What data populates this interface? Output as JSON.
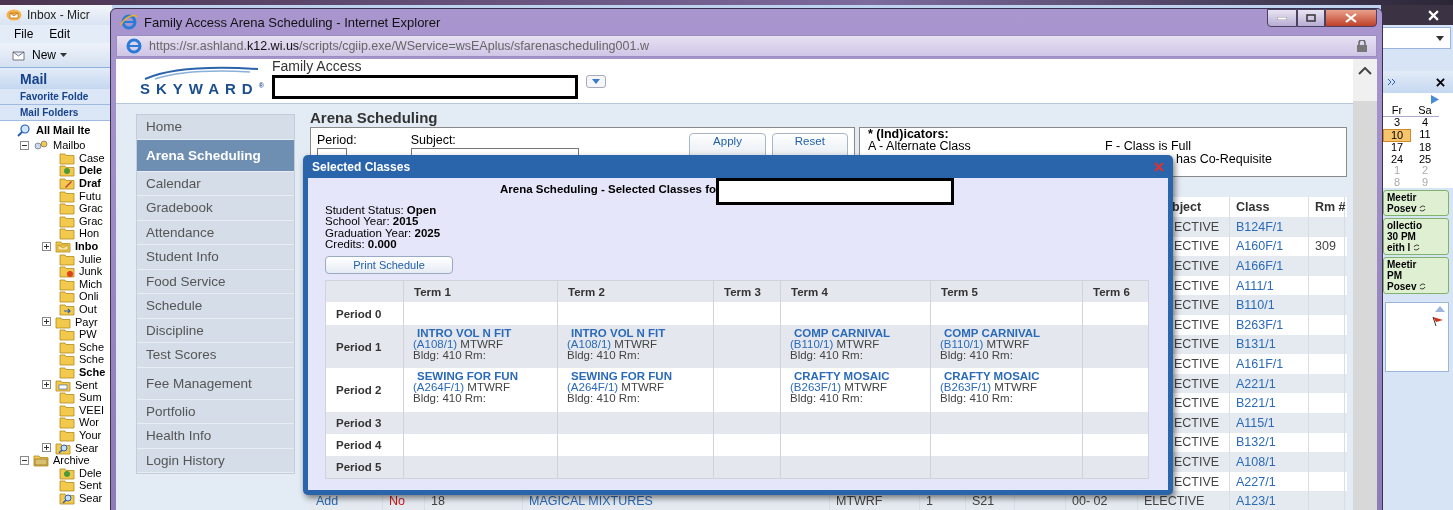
{
  "outlook": {
    "title": "Inbox - Micr",
    "menu": [
      "File",
      "Edit"
    ],
    "new_button": "New",
    "nav_title": "Mail",
    "sections": [
      "Favorite Folde",
      "Mail Folders"
    ],
    "all_items": "All Mail Ite",
    "folders": [
      {
        "label": "Mailbo",
        "kind": "mailbox",
        "unread": false,
        "expanded": true,
        "children": [
          {
            "label": "Case",
            "kind": "folder",
            "unread": false
          },
          {
            "label": "Dele",
            "kind": "trash",
            "unread": true
          },
          {
            "label": "Draf",
            "kind": "drafts",
            "unread": true
          },
          {
            "label": "Futu",
            "kind": "folder",
            "unread": false
          },
          {
            "label": "Grac",
            "kind": "folder",
            "unread": false
          },
          {
            "label": "Grac",
            "kind": "folder",
            "unread": false
          },
          {
            "label": "Hon",
            "kind": "folder",
            "unread": false
          },
          {
            "label": "Inbo",
            "kind": "inbox",
            "unread": true,
            "expanded": false
          },
          {
            "label": "Julie",
            "kind": "folder",
            "unread": false
          },
          {
            "label": "Junk",
            "kind": "junk",
            "unread": false
          },
          {
            "label": "Mich",
            "kind": "folder",
            "unread": false
          },
          {
            "label": "Onli",
            "kind": "folder",
            "unread": false
          },
          {
            "label": "Out",
            "kind": "outbox",
            "unread": false
          },
          {
            "label": "Payr",
            "kind": "folder",
            "unread": false,
            "expanded": false
          },
          {
            "label": "PW",
            "kind": "folder",
            "unread": false
          },
          {
            "label": "Sche",
            "kind": "folder",
            "unread": false
          },
          {
            "label": "Sche",
            "kind": "folder",
            "unread": false
          },
          {
            "label": "Sche",
            "kind": "folder",
            "unread": true
          },
          {
            "label": "Sent",
            "kind": "sent",
            "unread": false,
            "expanded": false
          },
          {
            "label": "Sum",
            "kind": "folder",
            "unread": false
          },
          {
            "label": "VEEI",
            "kind": "folder",
            "unread": false
          },
          {
            "label": "Wor",
            "kind": "folder",
            "unread": false
          },
          {
            "label": "Your",
            "kind": "folder",
            "unread": false
          },
          {
            "label": "Sear",
            "kind": "search",
            "unread": false,
            "expanded": false
          }
        ]
      },
      {
        "label": "Archive",
        "kind": "archive",
        "unread": false,
        "expanded": true,
        "children": [
          {
            "label": "Dele",
            "kind": "trash",
            "unread": false
          },
          {
            "label": "Sent",
            "kind": "folder",
            "unread": false
          },
          {
            "label": "Sear",
            "kind": "search",
            "unread": false
          }
        ]
      }
    ],
    "calendar": {
      "weekdays": [
        "Fr",
        "Sa"
      ],
      "weeks": [
        [
          {
            "label": "3",
            "selected": false,
            "muted": false
          },
          {
            "label": "4",
            "selected": false,
            "muted": false
          }
        ],
        [
          {
            "label": "10",
            "selected": true,
            "muted": false
          },
          {
            "label": "11",
            "selected": false,
            "muted": false
          }
        ],
        [
          {
            "label": "17",
            "selected": false,
            "muted": false
          },
          {
            "label": "18",
            "selected": false,
            "muted": false
          }
        ],
        [
          {
            "label": "24",
            "selected": false,
            "muted": false
          },
          {
            "label": "25",
            "selected": false,
            "muted": false
          }
        ],
        [
          {
            "label": "1",
            "selected": false,
            "muted": true
          },
          {
            "label": "2",
            "selected": false,
            "muted": true
          }
        ],
        [
          {
            "label": "8",
            "selected": false,
            "muted": true
          },
          {
            "label": "9",
            "selected": false,
            "muted": true
          }
        ]
      ]
    },
    "appointments": [
      {
        "lines": [
          "Meetir",
          "Posev"
        ],
        "recurring": true
      },
      {
        "lines": [
          "ollectio",
          "30 PM",
          "eith l"
        ],
        "recurring": true
      },
      {
        "lines": [
          "Meetir",
          "PM",
          "Posev"
        ],
        "recurring": true
      }
    ]
  },
  "browser": {
    "title": "Family Access Arena Scheduling - Internet Explorer",
    "url": "https://sr.ashland.**k12.wi.us**/scripts/cgiip.exe/WService=wsEAplus/sfarenascheduling001.w"
  },
  "header": {
    "logo": "SKYWARD$^{®}$",
    "app_name": "Family Access"
  },
  "sidebar": {
    "items": [
      {
        "label": "Home",
        "selected": false
      },
      {
        "label": "Arena Scheduling",
        "selected": true
      },
      {
        "label": "Calendar",
        "selected": false
      },
      {
        "label": "Gradebook",
        "selected": false
      },
      {
        "label": "Attendance",
        "selected": false
      },
      {
        "label": "Student Info",
        "selected": false
      },
      {
        "label": "Food Service",
        "selected": false
      },
      {
        "label": "Schedule",
        "selected": false
      },
      {
        "label": "Discipline",
        "selected": false
      },
      {
        "label": "Test Scores",
        "selected": false
      },
      {
        "label": "Fee Management",
        "selected": false
      },
      {
        "label": "Portfolio",
        "selected": false
      },
      {
        "label": "Health Info",
        "selected": false
      },
      {
        "label": "Login History",
        "selected": false
      }
    ]
  },
  "page": {
    "title": "Arena Scheduling",
    "filters": {
      "period_label": "Period:",
      "subject_label": "Subject:",
      "buttons": [
        "Apply",
        "Reset"
      ]
    },
    "indicators": {
      "title": "* (Ind)icators:",
      "items": [
        "A - Alternate Class",
        "F - Class is Full",
        "has Co-Requisite"
      ]
    },
    "course_table": {
      "columns": [
        "bject",
        "Class",
        "Rm #"
      ],
      "rows": [
        {
          "subject": "ECTIVE",
          "class": "B124F/1"
        },
        {
          "subject": "ECTIVE",
          "class": "A160F/1",
          "rm": "309"
        },
        {
          "subject": "ECTIVE",
          "class": "A166F/1"
        },
        {
          "subject": "ECTIVE",
          "class": "A111/1"
        },
        {
          "subject": "ECTIVE",
          "class": "B110/1"
        },
        {
          "subject": "ECTIVE",
          "class": "B263F/1"
        },
        {
          "subject": "ECTIVE",
          "class": "B131/1"
        },
        {
          "subject": "ECTIVE",
          "class": "A161F/1"
        },
        {
          "subject": "ECTIVE",
          "class": "A221/1"
        },
        {
          "subject": "ECTIVE",
          "class": "B221/1"
        },
        {
          "subject": "ECTIVE",
          "class": "A115/1"
        },
        {
          "subject": "ECTIVE",
          "class": "B132/1"
        },
        {
          "subject": "ECTIVE",
          "class": "A108/1"
        },
        {
          "subject": "ECTIVE",
          "class": "A227/1"
        }
      ],
      "last_row": {
        "action": "Add",
        "full": "No",
        "column_3": "18",
        "course": "MAGICAL MIXTURES",
        "days": "MTWRF",
        "column_6": "1",
        "column_7": "S21",
        "column_9": "00- 02",
        "subject": "ELECTIVE",
        "class": "A123/1"
      }
    }
  },
  "dialog": {
    "title": "Selected Classes",
    "heading": "Arena Scheduling - Selected Classes fo",
    "info": [
      {
        "label": "Student Status:",
        "value": "Open"
      },
      {
        "label": "School Year:",
        "value": "2015"
      },
      {
        "label": "Graduation Year:",
        "value": "2025"
      },
      {
        "label": "Credits:",
        "value": "0.000"
      }
    ],
    "print_button": "Print Schedule",
    "schedule": {
      "columns": [
        "Term 1",
        "Term 2",
        "Term 3",
        "Term 4",
        "Term 5",
        "Term 6"
      ],
      "rows": [
        {
          "period": "Period 0",
          "cells": [
            null,
            null,
            null,
            null,
            null,
            null
          ]
        },
        {
          "period": "Period 1",
          "cells": [
            {
              "title": "INTRO VOL N FIT",
              "code": "(A108/1)",
              "days": "MTWRF",
              "location": "Bldg: 410 Rm:"
            },
            {
              "title": "INTRO VOL N FIT",
              "code": "(A108/1)",
              "days": "MTWRF",
              "location": "Bldg: 410 Rm:"
            },
            null,
            {
              "title": "COMP CARNIVAL",
              "code": "(B110/1)",
              "days": "MTWRF",
              "location": "Bldg: 410 Rm:"
            },
            {
              "title": "COMP CARNIVAL",
              "code": "(B110/1)",
              "days": "MTWRF",
              "location": "Bldg: 410 Rm:"
            },
            null
          ]
        },
        {
          "period": "Period 2",
          "cells": [
            {
              "title": "SEWING FOR FUN",
              "code": "(A264F/1)",
              "days": "MTWRF",
              "location": "Bldg: 410 Rm:"
            },
            {
              "title": "SEWING FOR FUN",
              "code": "(A264F/1)",
              "days": "MTWRF",
              "location": "Bldg: 410 Rm:"
            },
            null,
            {
              "title": "CRAFTY MOSAIC",
              "code": "(B263F/1)",
              "days": "MTWRF",
              "location": "Bldg: 410 Rm:"
            },
            {
              "title": "CRAFTY MOSAIC",
              "code": "(B263F/1)",
              "days": "MTWRF",
              "location": "Bldg: 410 Rm:"
            },
            null
          ]
        },
        {
          "period": "Period 3",
          "cells": [
            null,
            null,
            null,
            null,
            null,
            null
          ]
        },
        {
          "period": "Period 4",
          "cells": [
            null,
            null,
            null,
            null,
            null,
            null
          ]
        },
        {
          "period": "Period 5",
          "cells": [
            null,
            null,
            null,
            null,
            null,
            null
          ]
        }
      ]
    }
  }
}
